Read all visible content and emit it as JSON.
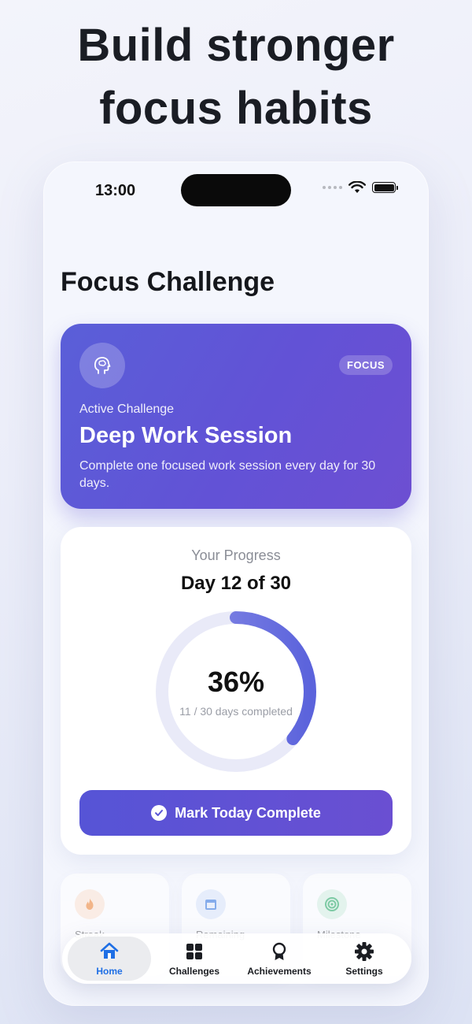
{
  "headline": {
    "line1": "Build stronger",
    "line2": "focus habits"
  },
  "status_bar": {
    "time": "13:00"
  },
  "page": {
    "title": "Focus Challenge"
  },
  "active_challenge": {
    "tag": "FOCUS",
    "kicker": "Active Challenge",
    "title": "Deep Work Session",
    "description": "Complete one focused work session every day for 30 days.",
    "icon": "brain-icon"
  },
  "progress": {
    "label": "Your Progress",
    "day_text": "Day 12 of 30",
    "percent_text": "36%",
    "percent_value": 0.36,
    "completed_text": "11 / 30 days completed",
    "cta_label": "Mark Today Complete"
  },
  "stats": [
    {
      "label": "Streak",
      "icon": "flame-icon",
      "color": "#f08a3c"
    },
    {
      "label": "Remaining",
      "icon": "calendar-icon",
      "color": "#3c7be0"
    },
    {
      "label": "Milestone",
      "icon": "target-icon",
      "color": "#2fae6a"
    }
  ],
  "tabs": [
    {
      "label": "Home",
      "icon": "home-icon",
      "active": true
    },
    {
      "label": "Challenges",
      "icon": "grid-icon",
      "active": false
    },
    {
      "label": "Achievements",
      "icon": "award-icon",
      "active": false
    },
    {
      "label": "Settings",
      "icon": "gear-icon",
      "active": false
    }
  ],
  "colors": {
    "accent": "#6252d6",
    "tab_active": "#1f6fe5"
  }
}
